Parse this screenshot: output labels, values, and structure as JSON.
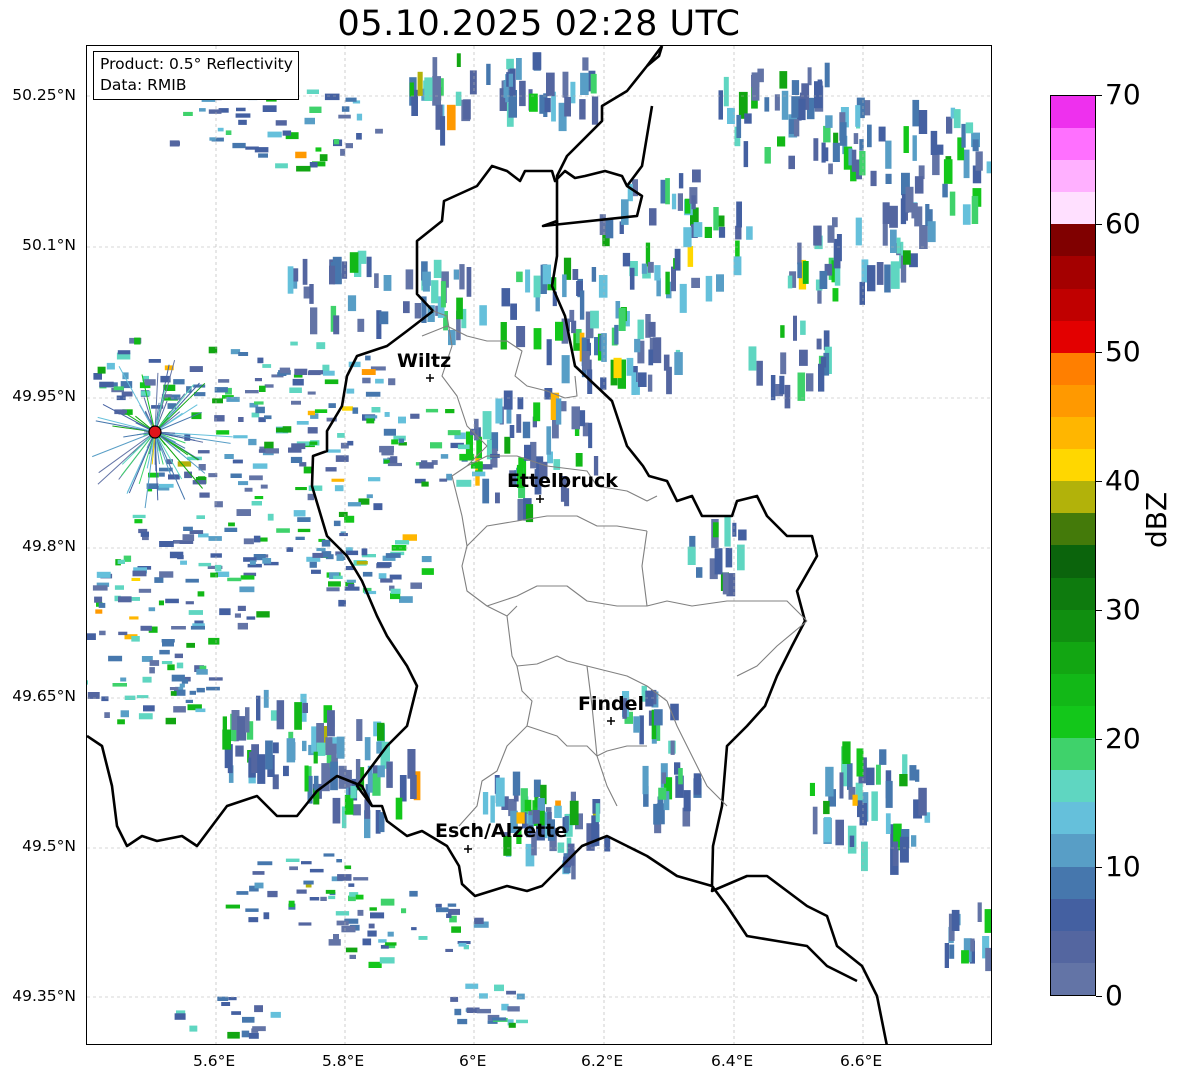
{
  "title": "05.10.2025 02:28 UTC",
  "info_box": {
    "product": "Product: 0.5° Reflectivity",
    "source": "Data: RMIB"
  },
  "axes": {
    "lat_labels": [
      "50.25°N",
      "50.1°N",
      "49.95°N",
      "49.8°N",
      "49.65°N",
      "49.5°N",
      "49.35°N"
    ],
    "lon_labels": [
      "5.6°E",
      "5.8°E",
      "6°E",
      "6.2°E",
      "6.4°E",
      "6.6°E"
    ],
    "gridlines": "dashed grey"
  },
  "cities": [
    {
      "name": "Wiltz"
    },
    {
      "name": "Ettelbruck"
    },
    {
      "name": "Findel"
    },
    {
      "name": "Esch/Alzette"
    }
  ],
  "radar_site_marker": {
    "color": "#e0141a"
  },
  "colorbar": {
    "title": "dBZ",
    "min": 0,
    "max": 70,
    "tick_labels": [
      "0",
      "10",
      "20",
      "30",
      "40",
      "50",
      "60",
      "70"
    ],
    "colors": [
      "#6374a6",
      "#5466a0",
      "#4460a1",
      "#4677ad",
      "#589ec6",
      "#65c0db",
      "#5fd6c1",
      "#3fd26b",
      "#13c71a",
      "#12b817",
      "#12a612",
      "#108f10",
      "#0e7b0e",
      "#0b640c",
      "#447a0a",
      "#b2b20a",
      "#ffd700",
      "#ffb600",
      "#ff9900",
      "#ff7f00",
      "#e30000",
      "#c00000",
      "#a40000",
      "#800000",
      "#ffe0ff",
      "#ffb0ff",
      "#ff70ff",
      "#ee30ee"
    ]
  },
  "colors": {
    "country_border": "#000000",
    "canton_border": "#808080",
    "grid": "#b0b0b0"
  }
}
